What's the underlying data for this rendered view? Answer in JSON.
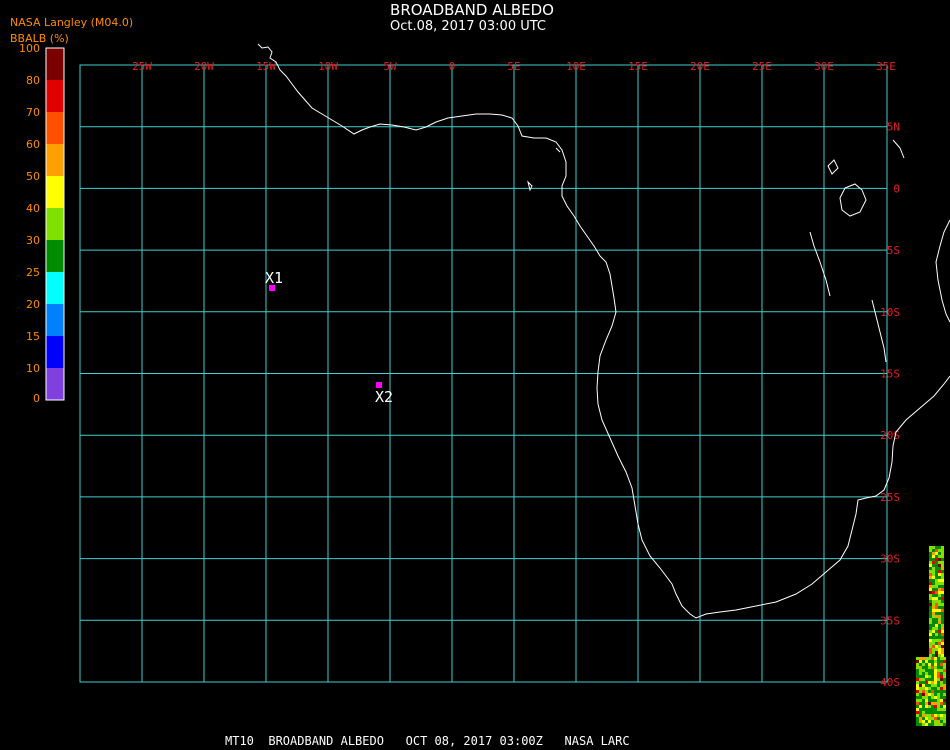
{
  "header": {
    "title": "BROADBAND ALBEDO",
    "datetime": "Oct.08, 2017 03:00 UTC",
    "source": "NASA Langley (M04.0)",
    "colorbar_label": "BBALB (%)"
  },
  "colorbar": {
    "ticks": [
      "100",
      "80",
      "70",
      "60",
      "50",
      "40",
      "30",
      "25",
      "20",
      "15",
      "10",
      "0"
    ],
    "colors": [
      "#7a0000",
      "#e00000",
      "#ff5000",
      "#ffa000",
      "#ffff00",
      "#80e000",
      "#008c00",
      "#00ffff",
      "#0080ff",
      "#0000ff",
      "#8040e0"
    ]
  },
  "grid": {
    "lon_labels": [
      "25W",
      "20W",
      "15W",
      "10W",
      "5W",
      "0",
      "5E",
      "10E",
      "15E",
      "20E",
      "25E",
      "30E",
      "35E"
    ],
    "lat_labels": [
      "5N",
      "0",
      "5S",
      "10S",
      "15S",
      "20S",
      "25S",
      "30S",
      "35S",
      "40S"
    ],
    "line_color": "#40d0d0",
    "label_color": "#e02020"
  },
  "markers": [
    {
      "label": "X1",
      "color": "#ff00ff"
    },
    {
      "label": "X2",
      "color": "#ff00ff"
    }
  ],
  "footer": "MT10  BROADBAND ALBEDO   OCT 08, 2017 03:00Z   NASA LARC"
}
